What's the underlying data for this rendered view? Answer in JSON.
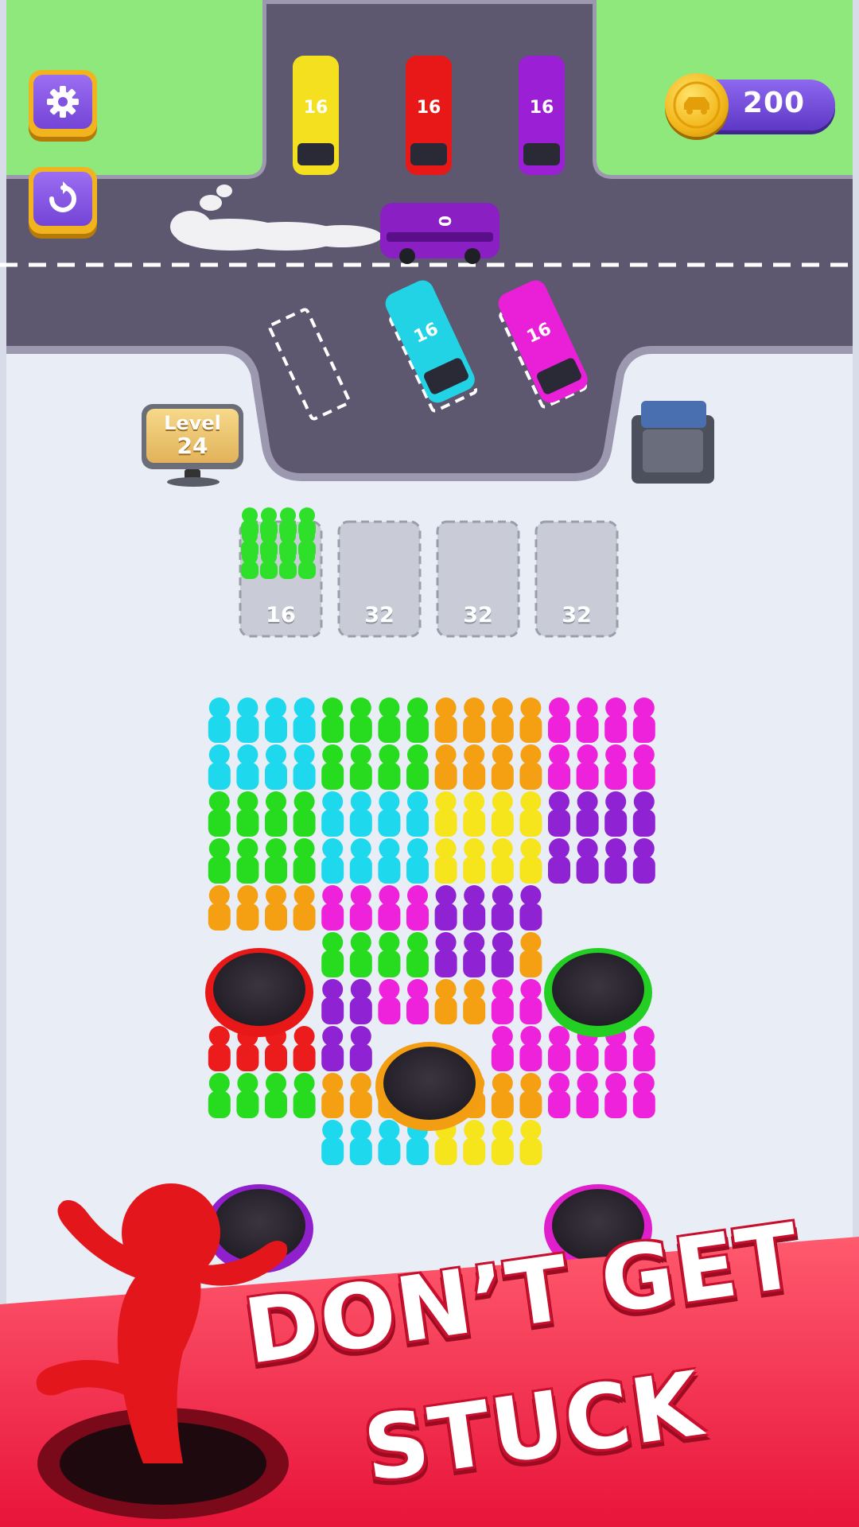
{
  "hud": {
    "settings_icon": "gear-icon",
    "restart_icon": "restart-icon",
    "coins": "200",
    "coin_icon": "coin-car-icon"
  },
  "level": {
    "label": "Level",
    "number": "24"
  },
  "parked_buses": [
    {
      "color": "#f5e020",
      "count": "16"
    },
    {
      "color": "#e81818",
      "count": "16"
    },
    {
      "color": "#9b1fd4",
      "count": "16"
    }
  ],
  "departing_bus": {
    "color": "#8a1fc4",
    "count": "0"
  },
  "waiting_buses": [
    {
      "color": "#22d3e6",
      "count": "16"
    },
    {
      "color": "#ea1fd8",
      "count": "16"
    }
  ],
  "queue_slots": [
    {
      "label": "16",
      "fill_color": "#2fe02a",
      "filled": true
    },
    {
      "label": "32",
      "filled": false
    },
    {
      "label": "32",
      "filled": false
    },
    {
      "label": "32",
      "filled": false
    }
  ],
  "colors": {
    "cyan": "#1ed8ee",
    "green": "#27dc1e",
    "orange": "#f4a012",
    "magenta": "#ef22dc",
    "purple": "#8f22d2",
    "yellow": "#f6e41c",
    "red": "#ec1c1c",
    "road": "#5d5770",
    "grass": "#8fe87c",
    "banner": "#f0224a"
  },
  "holes": [
    {
      "color": "#e81818"
    },
    {
      "color": "#22cf22"
    },
    {
      "color": "#f29d12"
    },
    {
      "color": "#9020cc"
    },
    {
      "color": "#e01fcc"
    }
  ],
  "banner": {
    "line1": "DON’T GET",
    "line2": "STUCK"
  }
}
